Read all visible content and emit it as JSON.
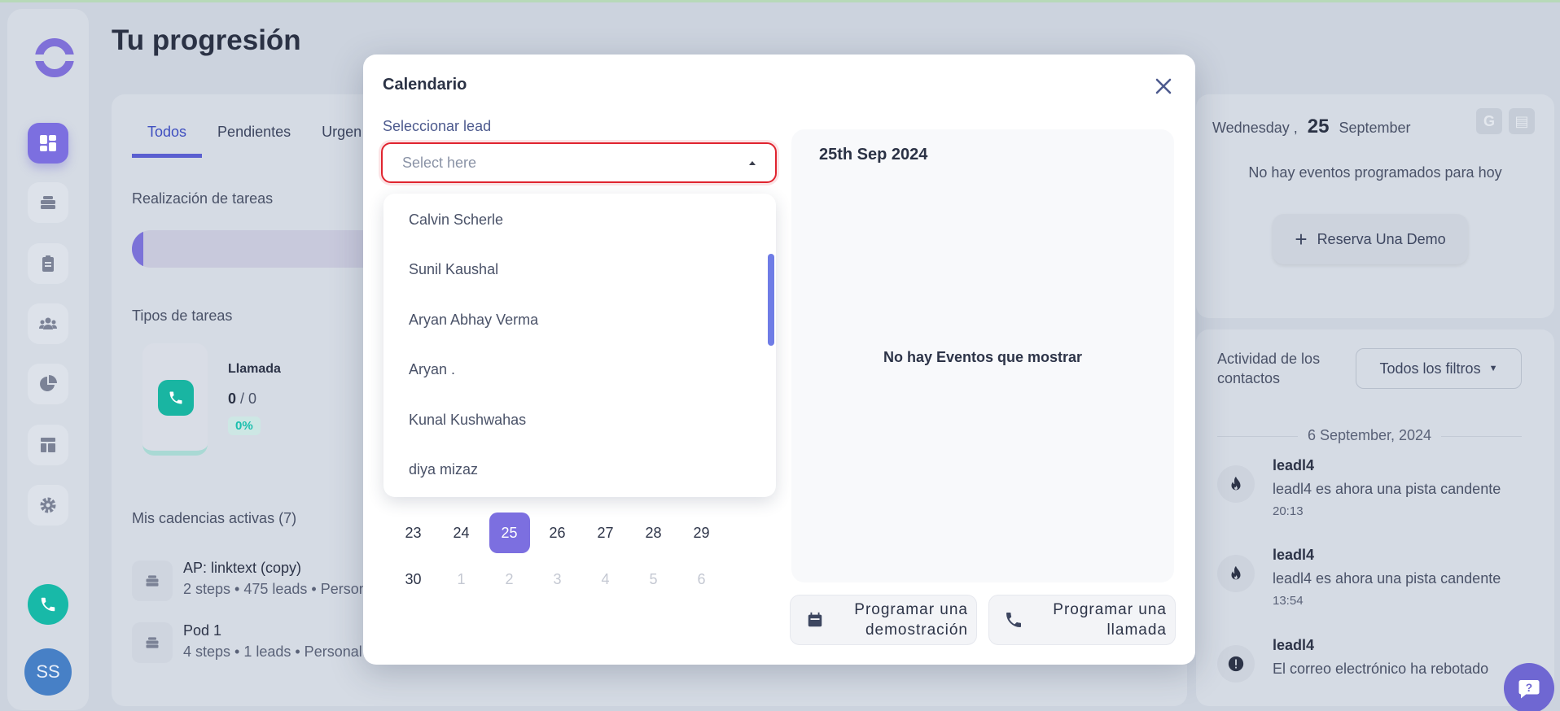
{
  "page": {
    "title": "Tu progresión"
  },
  "sidebar": {
    "items": [
      {
        "icon": "dashboard-icon",
        "active": true
      },
      {
        "icon": "cadences-icon"
      },
      {
        "icon": "clipboard-icon"
      },
      {
        "icon": "contacts-icon"
      },
      {
        "icon": "pie-chart-icon"
      },
      {
        "icon": "templates-icon"
      },
      {
        "icon": "gear-icon"
      }
    ],
    "avatar_initials": "SS"
  },
  "main": {
    "tabs": [
      "Todos",
      "Pendientes",
      "Urgen"
    ],
    "task_completion_label": "Realización de tareas",
    "task_types_label": "Tipos de tareas",
    "task_type": {
      "title": "Llamada",
      "done": "0",
      "total": "/ 0",
      "percent": "0%"
    },
    "cadences_label": "Mis cadencias activas (7)",
    "cadences": [
      {
        "name": "AP: linktext (copy)",
        "meta": "2 steps • 475 leads • Person"
      },
      {
        "name": "Pod 1",
        "meta": "4 steps • 1 leads • Personal"
      }
    ]
  },
  "right_top": {
    "weekday": "Wednesday ,",
    "day": "25",
    "month": "September",
    "empty_text": "No hay eventos programados para hoy",
    "demo_button": "Reserva Una Demo"
  },
  "right_bottom": {
    "title": "Actividad de los contactos",
    "filter_label": "Todos los filtros",
    "date_separator": "6 September, 2024",
    "activities": [
      {
        "name": "leadl4",
        "text": "leadl4 es ahora una pista candente",
        "time": "20:13",
        "icon": "fire-icon"
      },
      {
        "name": "leadl4",
        "text": "leadl4 es ahora una pista candente",
        "time": "13:54",
        "icon": "fire-icon"
      },
      {
        "name": "leadl4",
        "text": "El correo electrónico ha rebotado",
        "time": "",
        "icon": "alert-icon"
      }
    ]
  },
  "modal": {
    "title": "Calendario",
    "lead_label": "Seleccionar lead",
    "select_placeholder": "Select here",
    "leads": [
      "Calvin Scherle",
      "Sunil Kaushal",
      "Aryan Abhay Verma",
      "Aryan .",
      "Kunal Kushwahas",
      "diya mizaz"
    ],
    "calendar_rows": [
      [
        "23",
        "24",
        "25",
        "26",
        "27",
        "28",
        "29"
      ],
      [
        "30",
        "1",
        "2",
        "3",
        "4",
        "5",
        "6"
      ]
    ],
    "selected_day": "25",
    "events_date": "25th Sep 2024",
    "events_empty": "No hay Eventos que mostrar",
    "btn_demo_line1": "Programar una",
    "btn_demo_line2": "demostración",
    "btn_call_line1": "Programar una",
    "btn_call_line2": "llamada"
  },
  "colors": {
    "accent": "#7c6fe0",
    "teal": "#18b9a8",
    "danger": "#e0242f"
  }
}
